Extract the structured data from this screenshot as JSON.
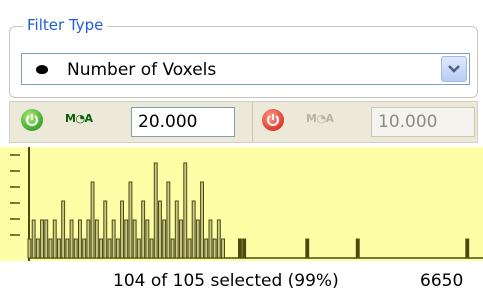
{
  "filter": {
    "group_title": "Filter Type",
    "selected_type": "Number of Voxels"
  },
  "threshold": {
    "min_value": "20.000",
    "max_value": "10.000",
    "min_enabled": true,
    "max_enabled": false
  },
  "colors": {
    "histogram_background": "#fefea6",
    "bar_color": "#4d4a0f",
    "highlight_fill": "#cbc98f",
    "power_on": "#3aa52c",
    "power_off": "#e03a2a"
  },
  "chart_data": {
    "type": "bar",
    "title": "",
    "xlabel": "",
    "ylabel": "",
    "ylim": [
      0,
      1
    ],
    "values": [
      1,
      2,
      1,
      2,
      2,
      1,
      2,
      1,
      3,
      1,
      2,
      1,
      2,
      1,
      2,
      4,
      2,
      1,
      3,
      1,
      2,
      1,
      3,
      2,
      4,
      2,
      1,
      3,
      2,
      1,
      5,
      3,
      2,
      4,
      1,
      3,
      2,
      5,
      1,
      3,
      2,
      4,
      1,
      2,
      1,
      2,
      1,
      0,
      0,
      0,
      1,
      1,
      0,
      0,
      0,
      0,
      0,
      0,
      0,
      0,
      0,
      0,
      0,
      0,
      0,
      0,
      1,
      0,
      0,
      0,
      0,
      0,
      0,
      0,
      0,
      0,
      0,
      0,
      1,
      0,
      0,
      0,
      0,
      0,
      0,
      0,
      0,
      0,
      0,
      0,
      0,
      0,
      0,
      0,
      0,
      0,
      0,
      0,
      0,
      0,
      0,
      0,
      0,
      0,
      1
    ]
  },
  "status": {
    "selection_text": "104 of 105 selected (99%)",
    "max_label": "6650"
  },
  "icons": {
    "min_toggle": "power-on-icon",
    "max_toggle": "power-off-icon",
    "dropdown": "chevron-down-icon",
    "bullet": "bullet-icon"
  }
}
